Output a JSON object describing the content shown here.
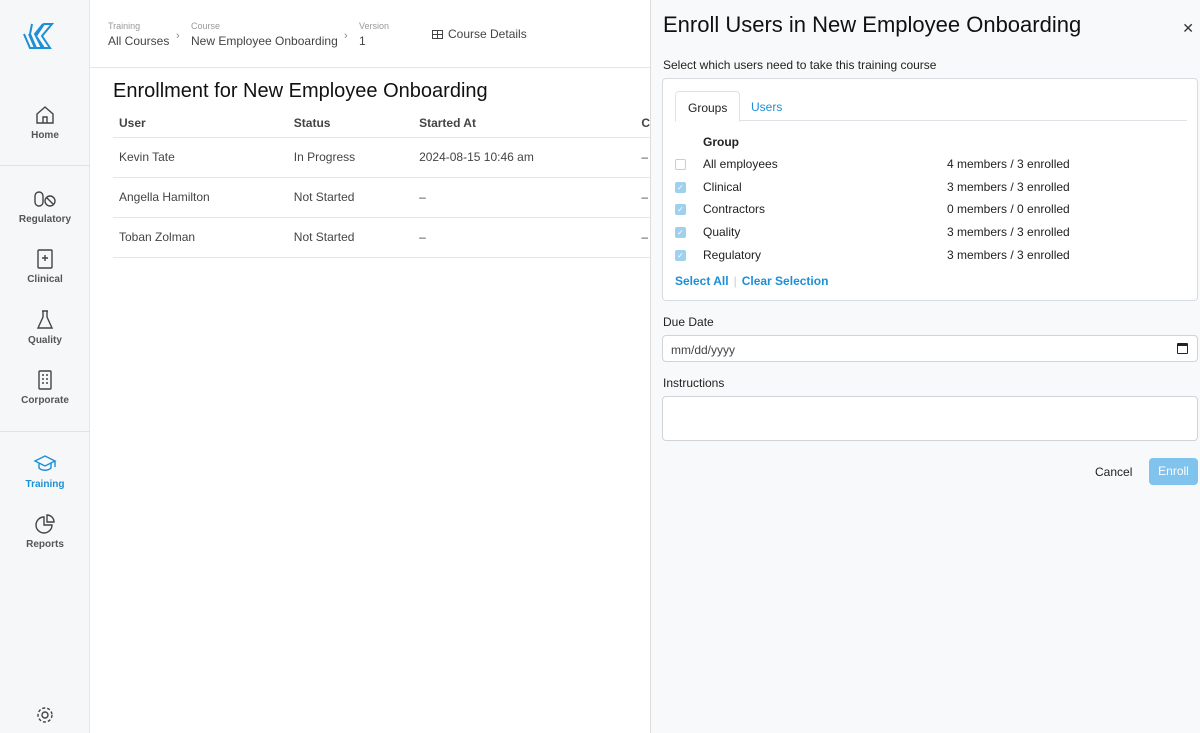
{
  "sidebar": {
    "items": [
      {
        "label": "Home"
      },
      {
        "label": "Regulatory"
      },
      {
        "label": "Clinical"
      },
      {
        "label": "Quality"
      },
      {
        "label": "Corporate"
      },
      {
        "label": "Training"
      },
      {
        "label": "Reports"
      }
    ],
    "accent": "#1c8fd6"
  },
  "breadcrumb": [
    {
      "small": "Training",
      "value": "All Courses"
    },
    {
      "small": "Course",
      "value": "New Employee Onboarding"
    },
    {
      "small": "Version",
      "value": "1"
    }
  ],
  "course_details": "Course Details",
  "page_title": "Enrollment for New Employee Onboarding",
  "table": {
    "headers": [
      "User",
      "Status",
      "Started At",
      "C"
    ],
    "rows": [
      [
        "Kevin Tate",
        "In Progress",
        "2024-08-15 10:46 am",
        "–"
      ],
      [
        "Angella Hamilton",
        "Not Started",
        "–",
        "–"
      ],
      [
        "Toban Zolman",
        "Not Started",
        "–",
        "–"
      ]
    ]
  },
  "panel": {
    "title": "Enroll Users in New Employee Onboarding",
    "subtitle": "Select which users need to take this training course",
    "tabs": [
      "Groups",
      "Users"
    ],
    "group_header": "Group",
    "groups": [
      {
        "name": "All employees",
        "info": "4 members / 3 enrolled",
        "checked": false
      },
      {
        "name": "Clinical",
        "info": "3 members / 3 enrolled",
        "checked": true
      },
      {
        "name": "Contractors",
        "info": "0 members / 0 enrolled",
        "checked": true
      },
      {
        "name": "Quality",
        "info": "3 members / 3 enrolled",
        "checked": true
      },
      {
        "name": "Regulatory",
        "info": "3 members / 3 enrolled",
        "checked": true
      }
    ],
    "select_all": "Select All",
    "clear_selection": "Clear Selection",
    "due_date_label": "Due Date",
    "due_date_placeholder": "mm/dd/yyyy",
    "instructions_label": "Instructions",
    "cancel": "Cancel",
    "enroll": "Enroll"
  }
}
